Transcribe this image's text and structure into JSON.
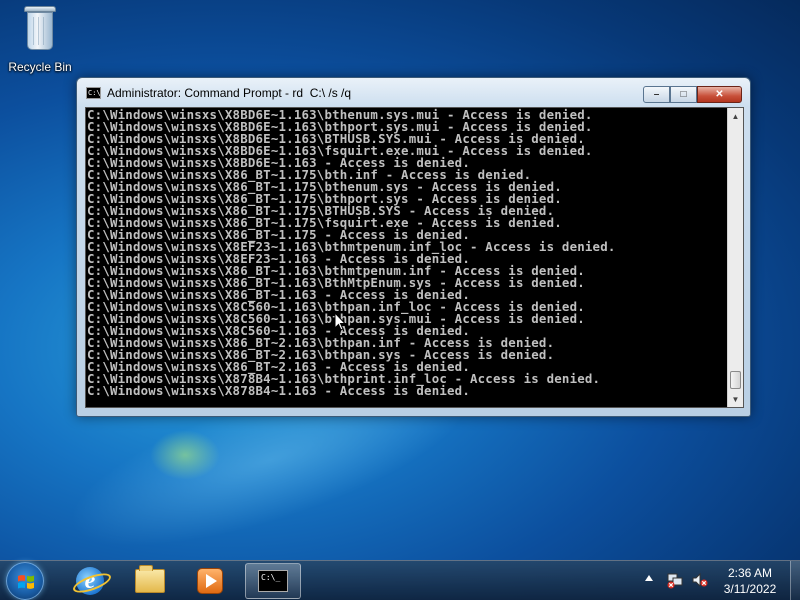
{
  "desktop": {
    "recycle_bin_label": "Recycle Bin"
  },
  "window": {
    "title": "Administrator: Command Prompt - rd  C:\\ /s /q",
    "minimize_glyph": "–",
    "maximize_glyph": "□",
    "close_glyph": "✕",
    "console_lines": [
      "C:\\Windows\\winsxs\\X8BD6E~1.163\\bthenum.sys.mui - Access is denied.",
      "C:\\Windows\\winsxs\\X8BD6E~1.163\\bthport.sys.mui - Access is denied.",
      "C:\\Windows\\winsxs\\X8BD6E~1.163\\BTHUSB.SYS.mui - Access is denied.",
      "C:\\Windows\\winsxs\\X8BD6E~1.163\\fsquirt.exe.mui - Access is denied.",
      "C:\\Windows\\winsxs\\X8BD6E~1.163 - Access is denied.",
      "C:\\Windows\\winsxs\\X86_BT~1.175\\bth.inf - Access is denied.",
      "C:\\Windows\\winsxs\\X86_BT~1.175\\bthenum.sys - Access is denied.",
      "C:\\Windows\\winsxs\\X86_BT~1.175\\bthport.sys - Access is denied.",
      "C:\\Windows\\winsxs\\X86_BT~1.175\\BTHUSB.SYS - Access is denied.",
      "C:\\Windows\\winsxs\\X86_BT~1.175\\fsquirt.exe - Access is denied.",
      "C:\\Windows\\winsxs\\X86_BT~1.175 - Access is denied.",
      "C:\\Windows\\winsxs\\X8EF23~1.163\\bthmtpenum.inf_loc - Access is denied.",
      "C:\\Windows\\winsxs\\X8EF23~1.163 - Access is denied.",
      "C:\\Windows\\winsxs\\X86_BT~1.163\\bthmtpenum.inf - Access is denied.",
      "C:\\Windows\\winsxs\\X86_BT~1.163\\BthMtpEnum.sys - Access is denied.",
      "C:\\Windows\\winsxs\\X86_BT~1.163 - Access is denied.",
      "C:\\Windows\\winsxs\\X8C560~1.163\\bthpan.inf_loc - Access is denied.",
      "C:\\Windows\\winsxs\\X8C560~1.163\\bthpan.sys.mui - Access is denied.",
      "C:\\Windows\\winsxs\\X8C560~1.163 - Access is denied.",
      "C:\\Windows\\winsxs\\X86_BT~2.163\\bthpan.inf - Access is denied.",
      "C:\\Windows\\winsxs\\X86_BT~2.163\\bthpan.sys - Access is denied.",
      "C:\\Windows\\winsxs\\X86_BT~2.163 - Access is denied.",
      "C:\\Windows\\winsxs\\X878B4~1.163\\bthprint.inf_loc - Access is denied.",
      "C:\\Windows\\winsxs\\X878B4~1.163 - Access is denied."
    ]
  },
  "taskbar": {
    "start_icon": "windows-logo-icon",
    "pinned": [
      "internet-explorer-icon",
      "windows-explorer-icon",
      "media-player-icon",
      "command-prompt-icon"
    ],
    "clock_time": "2:36 AM",
    "clock_date": "3/11/2022"
  }
}
